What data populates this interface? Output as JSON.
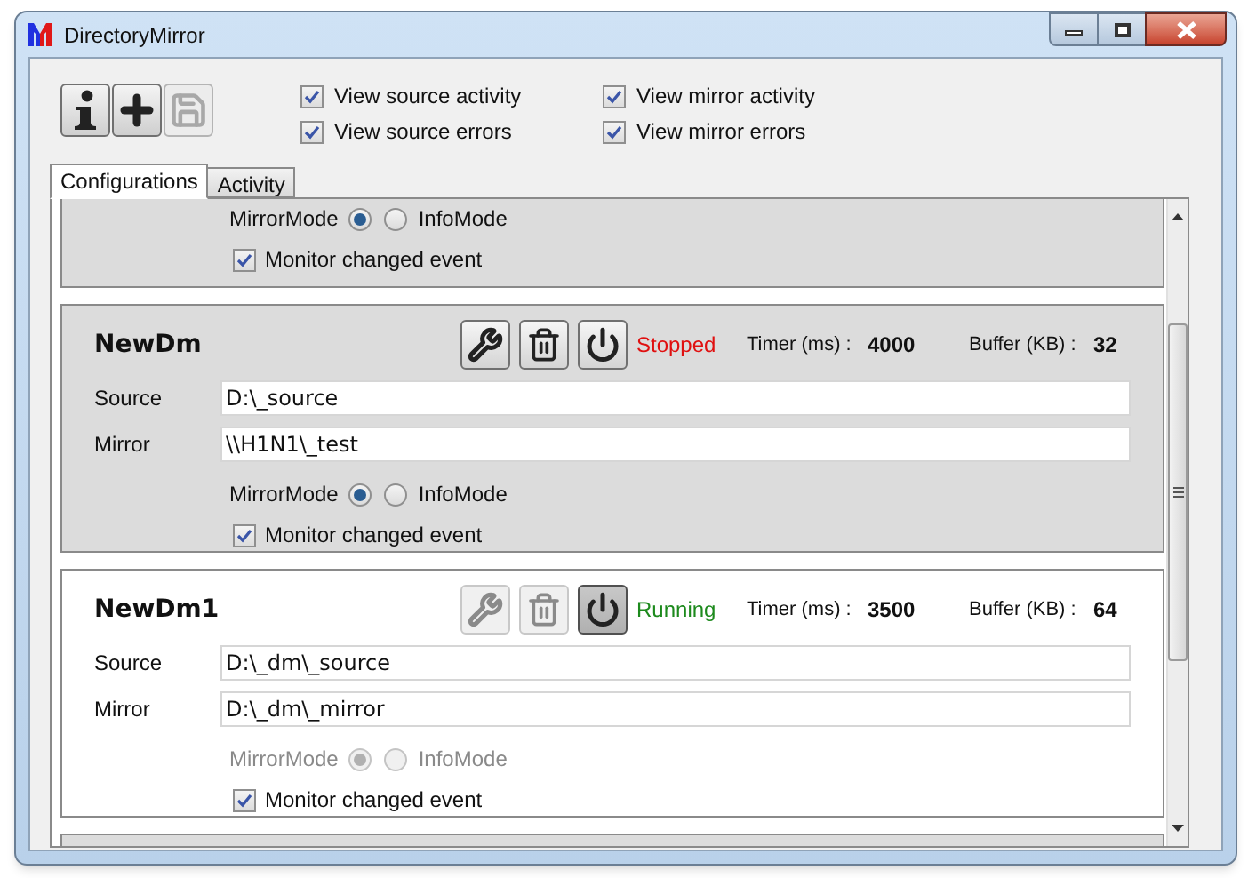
{
  "window": {
    "title": "DirectoryMirror"
  },
  "toolbar": [
    {
      "kind": "info",
      "disabled": false
    },
    {
      "kind": "add",
      "disabled": false
    },
    {
      "kind": "save",
      "disabled": true
    }
  ],
  "options": [
    {
      "label": "View source activity",
      "checked": true
    },
    {
      "label": "View mirror activity",
      "checked": true
    },
    {
      "label": "View source errors",
      "checked": true
    },
    {
      "label": "View mirror errors",
      "checked": true
    }
  ],
  "tabs": [
    {
      "label": "Configurations",
      "selected": true
    },
    {
      "label": "Activity",
      "selected": false
    }
  ],
  "configurations": [
    {
      "kind": "partial",
      "running": false,
      "modes": [
        {
          "label": "MirrorMode",
          "selected": true
        },
        {
          "label": "InfoMode",
          "selected": false
        }
      ],
      "monitor": {
        "label": "Monitor changed event",
        "checked": true
      }
    },
    {
      "kind": "full",
      "name": "NewDm",
      "running": false,
      "status": "Stopped",
      "timer_label": "Timer (ms) :",
      "timer": "4000",
      "buffer_label": "Buffer (KB) :",
      "buffer": "32",
      "source_label": "Source",
      "source": "D:\\_source",
      "mirror_label": "Mirror",
      "mirror": "\\\\H1N1\\_test",
      "modes": [
        {
          "label": "MirrorMode",
          "selected": true
        },
        {
          "label": "InfoMode",
          "selected": false
        }
      ],
      "monitor": {
        "label": "Monitor changed event",
        "checked": true
      }
    },
    {
      "kind": "full",
      "name": "NewDm1",
      "running": true,
      "status": "Running",
      "timer_label": "Timer (ms) :",
      "timer": "3500",
      "buffer_label": "Buffer (KB) :",
      "buffer": "64",
      "source_label": "Source",
      "source": "D:\\_dm\\_source",
      "mirror_label": "Mirror",
      "mirror": "D:\\_dm\\_mirror",
      "modes": [
        {
          "label": "MirrorMode",
          "selected": true
        },
        {
          "label": "InfoMode",
          "selected": false
        }
      ],
      "monitor": {
        "label": "Monitor changed event",
        "checked": true
      }
    }
  ]
}
